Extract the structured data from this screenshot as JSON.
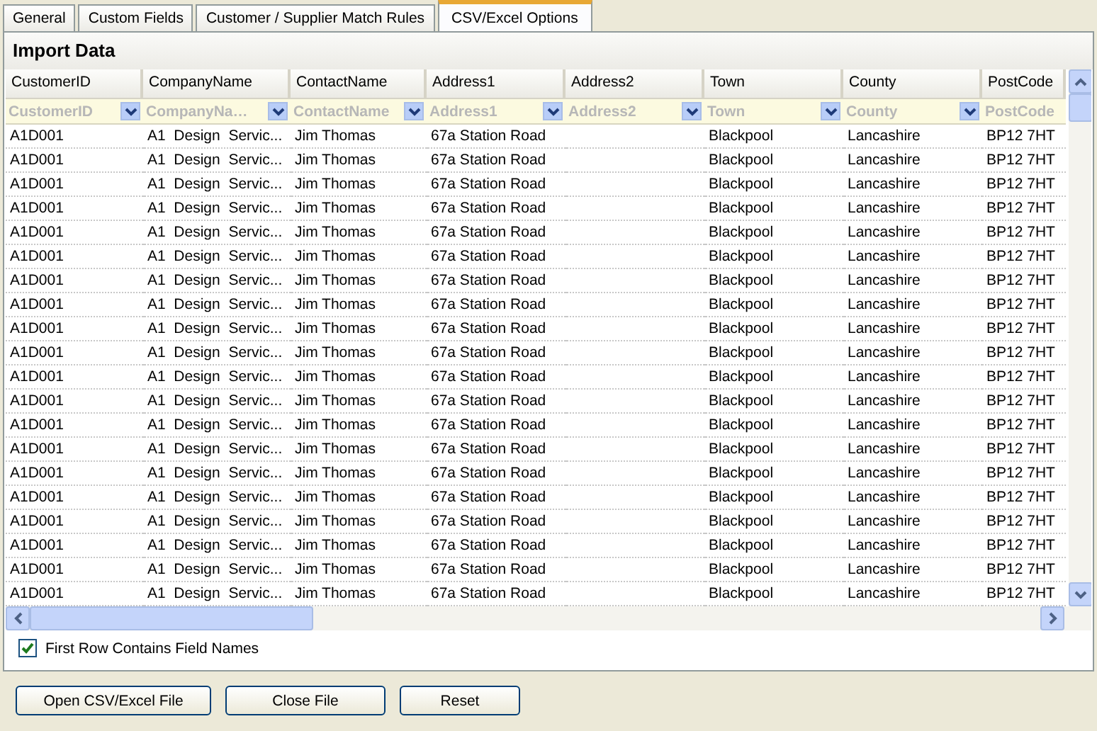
{
  "tabs": [
    {
      "label": "General",
      "selected": false
    },
    {
      "label": "Custom Fields",
      "selected": false
    },
    {
      "label": "Customer / Supplier Match Rules",
      "selected": false
    },
    {
      "label": "CSV/Excel Options",
      "selected": true
    }
  ],
  "panel": {
    "title": "Import Data"
  },
  "table": {
    "columns": [
      {
        "label": "CustomerID",
        "filter": "CustomerID"
      },
      {
        "label": "CompanyName",
        "filter": "CompanyNa…"
      },
      {
        "label": "ContactName",
        "filter": "ContactName"
      },
      {
        "label": "Address1",
        "filter": "Address1"
      },
      {
        "label": "Address2",
        "filter": "Address2"
      },
      {
        "label": "Town",
        "filter": "Town"
      },
      {
        "label": "County",
        "filter": "County"
      },
      {
        "label": "PostCode",
        "filter": "PostCode"
      }
    ],
    "rows": [
      [
        "A1D001",
        "A1  Design  Servic...",
        "Jim Thomas",
        "67a Station Road",
        null,
        "Blackpool",
        "Lancashire",
        "BP12 7HT"
      ],
      [
        "A1D001",
        "A1  Design  Servic...",
        "Jim Thomas",
        "67a Station Road",
        null,
        "Blackpool",
        "Lancashire",
        "BP12 7HT"
      ],
      [
        "A1D001",
        "A1  Design  Servic...",
        "Jim Thomas",
        "67a Station Road",
        null,
        "Blackpool",
        "Lancashire",
        "BP12 7HT"
      ],
      [
        "A1D001",
        "A1  Design  Servic...",
        "Jim Thomas",
        "67a Station Road",
        null,
        "Blackpool",
        "Lancashire",
        "BP12 7HT"
      ],
      [
        "A1D001",
        "A1  Design  Servic...",
        "Jim Thomas",
        "67a Station Road",
        null,
        "Blackpool",
        "Lancashire",
        "BP12 7HT"
      ],
      [
        "A1D001",
        "A1  Design  Servic...",
        "Jim Thomas",
        "67a Station Road",
        null,
        "Blackpool",
        "Lancashire",
        "BP12 7HT"
      ],
      [
        "A1D001",
        "A1  Design  Servic...",
        "Jim Thomas",
        "67a Station Road",
        null,
        "Blackpool",
        "Lancashire",
        "BP12 7HT"
      ],
      [
        "A1D001",
        "A1  Design  Servic...",
        "Jim Thomas",
        "67a Station Road",
        null,
        "Blackpool",
        "Lancashire",
        "BP12 7HT"
      ],
      [
        "A1D001",
        "A1  Design  Servic...",
        "Jim Thomas",
        "67a Station Road",
        null,
        "Blackpool",
        "Lancashire",
        "BP12 7HT"
      ],
      [
        "A1D001",
        "A1  Design  Servic...",
        "Jim Thomas",
        "67a Station Road",
        null,
        "Blackpool",
        "Lancashire",
        "BP12 7HT"
      ],
      [
        "A1D001",
        "A1  Design  Servic...",
        "Jim Thomas",
        "67a Station Road",
        null,
        "Blackpool",
        "Lancashire",
        "BP12 7HT"
      ],
      [
        "A1D001",
        "A1  Design  Servic...",
        "Jim Thomas",
        "67a Station Road",
        null,
        "Blackpool",
        "Lancashire",
        "BP12 7HT"
      ],
      [
        "A1D001",
        "A1  Design  Servic...",
        "Jim Thomas",
        "67a Station Road",
        null,
        "Blackpool",
        "Lancashire",
        "BP12 7HT"
      ],
      [
        "A1D001",
        "A1  Design  Servic...",
        "Jim Thomas",
        "67a Station Road",
        null,
        "Blackpool",
        "Lancashire",
        "BP12 7HT"
      ],
      [
        "A1D001",
        "A1  Design  Servic...",
        "Jim Thomas",
        "67a Station Road",
        null,
        "Blackpool",
        "Lancashire",
        "BP12 7HT"
      ],
      [
        "A1D001",
        "A1  Design  Servic...",
        "Jim Thomas",
        "67a Station Road",
        null,
        "Blackpool",
        "Lancashire",
        "BP12 7HT"
      ],
      [
        "A1D001",
        "A1  Design  Servic...",
        "Jim Thomas",
        "67a Station Road",
        null,
        "Blackpool",
        "Lancashire",
        "BP12 7HT"
      ],
      [
        "A1D001",
        "A1  Design  Servic...",
        "Jim Thomas",
        "67a Station Road",
        null,
        "Blackpool",
        "Lancashire",
        "BP12 7HT"
      ],
      [
        "A1D001",
        "A1  Design  Servic...",
        "Jim Thomas",
        "67a Station Road",
        null,
        "Blackpool",
        "Lancashire",
        "BP12 7HT"
      ],
      [
        "A1D001",
        "A1  Design  Servic...",
        "Jim Thomas",
        "67a Station Road",
        null,
        "Blackpool",
        "Lancashire",
        "BP12 7HT"
      ]
    ]
  },
  "options": [
    {
      "label": "First Row Contains Field Names",
      "checked": true
    }
  ],
  "buttons": [
    "Open CSV/Excel File",
    "Close File",
    "Reset"
  ]
}
